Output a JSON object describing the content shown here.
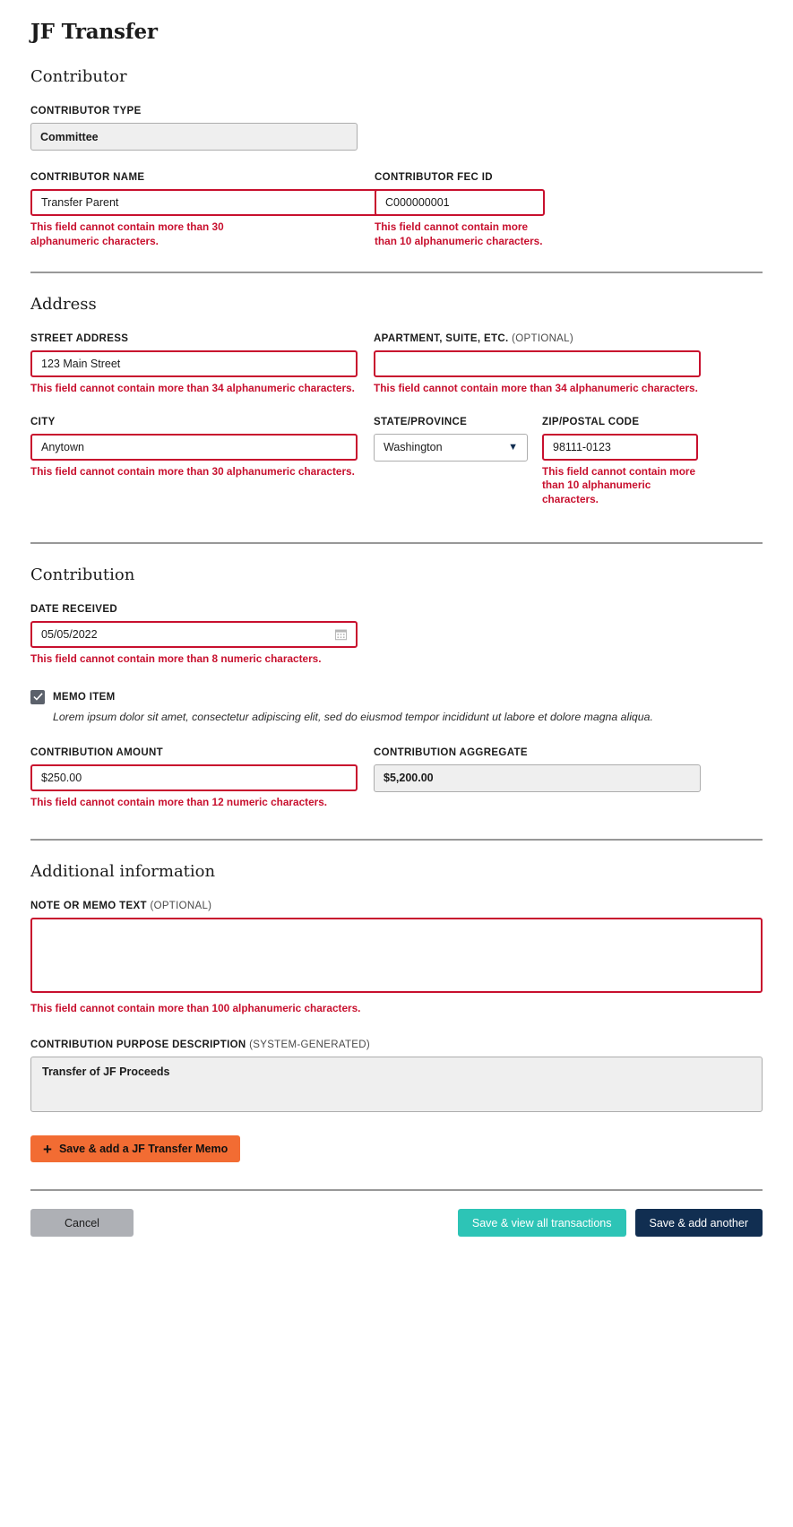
{
  "page": {
    "title": "JF Transfer"
  },
  "sections": {
    "contributor": {
      "heading": "Contributor",
      "type_label": "CONTRIBUTOR TYPE",
      "type_value": "Committee",
      "name_label": "CONTRIBUTOR NAME",
      "name_value": "Transfer Parent",
      "name_error": "This field cannot contain more than 30 alphanumeric characters.",
      "fec_label": "CONTRIBUTOR FEC ID",
      "fec_value": "C000000001",
      "fec_error": "This field cannot contain more than 10 alphanumeric characters."
    },
    "address": {
      "heading": "Address",
      "street_label": "STREET ADDRESS",
      "street_value": "123 Main Street",
      "street_error": "This field cannot contain more than 34 alphanumeric characters.",
      "apt_label": "APARTMENT, SUITE, ETC.",
      "apt_optional": "(OPTIONAL)",
      "apt_value": "",
      "apt_error": "This field cannot contain more than 34 alphanumeric characters.",
      "city_label": "CITY",
      "city_value": "Anytown",
      "city_error": "This field cannot contain more than 30 alphanumeric characters.",
      "state_label": "STATE/PROVINCE",
      "state_value": "Washington",
      "zip_label": "ZIP/POSTAL CODE",
      "zip_value": "98111-0123",
      "zip_error": "This field cannot contain more than 10 alphanumeric characters."
    },
    "contribution": {
      "heading": "Contribution",
      "date_label": "DATE RECEIVED",
      "date_value": "05/05/2022",
      "date_error": "This field cannot contain more than 8 numeric characters.",
      "memo_label": "MEMO ITEM",
      "memo_checked": true,
      "memo_help": "Lorem ipsum dolor sit amet, consectetur adipiscing elit, sed do eiusmod tempor incididunt ut labore et dolore magna aliqua.",
      "amount_label": "CONTRIBUTION AMOUNT",
      "amount_value": "$250.00",
      "amount_error": "This field cannot contain more than 12 numeric characters.",
      "aggregate_label": "CONTRIBUTION AGGREGATE",
      "aggregate_value": "$5,200.00"
    },
    "additional": {
      "heading": "Additional information",
      "note_label": "NOTE OR MEMO TEXT",
      "note_optional": "(OPTIONAL)",
      "note_value": "",
      "note_error": "This field cannot contain more than 100 alphanumeric characters.",
      "cpd_label": "CONTRIBUTION PURPOSE DESCRIPTION",
      "cpd_optional": "(SYSTEM-GENERATED)",
      "cpd_value": "Transfer of JF Proceeds"
    }
  },
  "buttons": {
    "memo": "Save & add a JF Transfer Memo",
    "memo_icon": "plus-icon",
    "cancel": "Cancel",
    "save_view": "Save & view all transactions",
    "save_another": "Save & add another"
  },
  "colors": {
    "error": "#c8102e",
    "orange": "#f26c33",
    "teal": "#2dc4b6",
    "navy": "#112e51",
    "gray": "#aeb0b5"
  }
}
